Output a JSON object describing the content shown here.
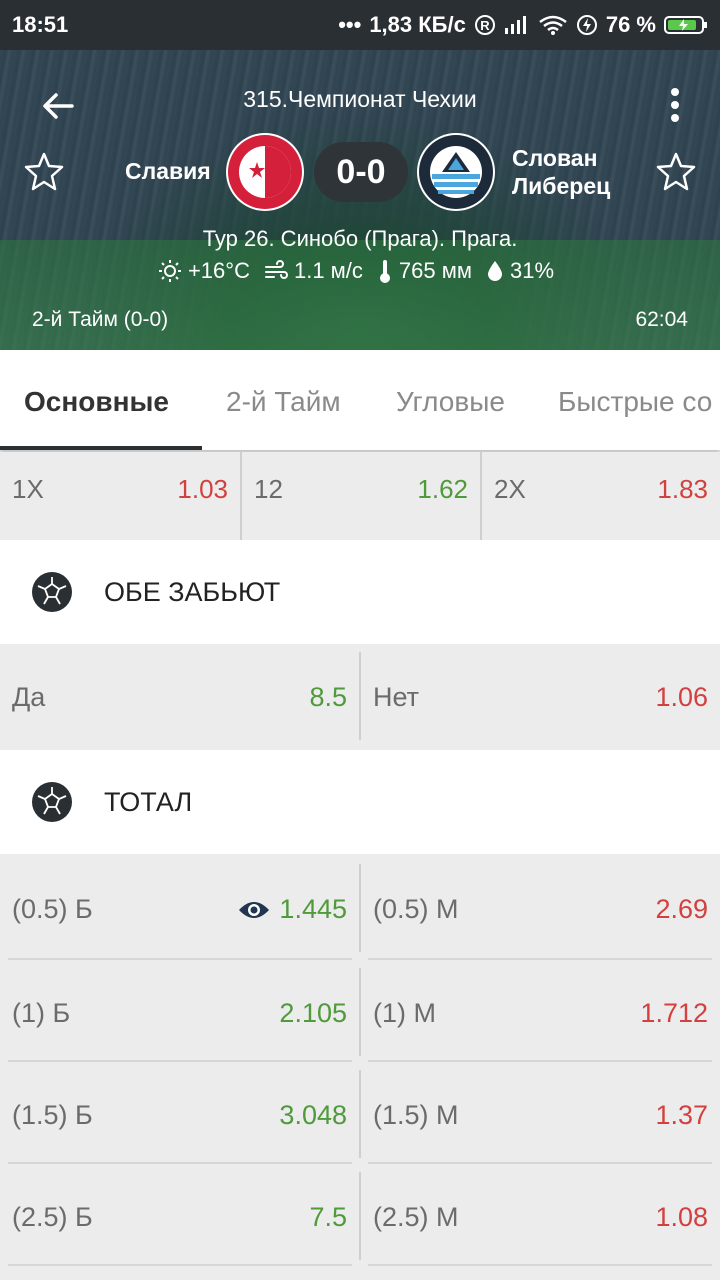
{
  "status_bar": {
    "time": "18:51",
    "dots": "•••",
    "network_speed": "1,83 КБ/с",
    "battery_percent": "76 %"
  },
  "header": {
    "league": "315.Чемпионат Чехии",
    "home_team": "Славия",
    "away_team_line1": "Слован",
    "away_team_line2": "Либерец",
    "score": "0-0",
    "venue": "Тур 26. Синобо (Прага). Прага.",
    "temperature": "+16°C",
    "wind": "1.1 м/с",
    "pressure": "765 мм",
    "humidity": "31%",
    "period": "2-й  Тайм (0-0)",
    "clock": "62:04"
  },
  "tabs": [
    "Основные",
    "2-й  Тайм",
    "Угловые",
    "Быстрые со"
  ],
  "double_chance": [
    {
      "label": "1X",
      "odd": "1.03",
      "trend": "down"
    },
    {
      "label": "12",
      "odd": "1.62",
      "trend": "up"
    },
    {
      "label": "2X",
      "odd": "1.83",
      "trend": "down"
    }
  ],
  "sections": {
    "both_score": {
      "title": "ОБЕ ЗАБЬЮТ",
      "yes_label": "Да",
      "yes_odd": "8.5",
      "no_label": "Нет",
      "no_odd": "1.06"
    },
    "total": {
      "title": "ТОТАЛ",
      "rows": [
        {
          "over_label": "(0.5) Б",
          "over_odd": "1.445",
          "under_label": "(0.5) М",
          "under_odd": "2.69"
        },
        {
          "over_label": "(1) Б",
          "over_odd": "2.105",
          "under_label": "(1) М",
          "under_odd": "1.712"
        },
        {
          "over_label": "(1.5) Б",
          "over_odd": "3.048",
          "under_label": "(1.5) М",
          "under_odd": "1.37"
        },
        {
          "over_label": "(2.5) Б",
          "over_odd": "7.5",
          "under_label": "(2.5) М",
          "under_odd": "1.08"
        }
      ]
    }
  },
  "colors": {
    "up": "#4f9a3a",
    "down": "#d2403f",
    "dark": "#2a2f33"
  },
  "icons": [
    "back-arrow-icon",
    "more-vert-icon",
    "star-outline-icon",
    "sun-icon",
    "wind-icon",
    "thermometer-icon",
    "drop-icon",
    "soccer-ball-icon",
    "eye-icon",
    "wifi-icon",
    "battery-icon",
    "signal-icon"
  ]
}
